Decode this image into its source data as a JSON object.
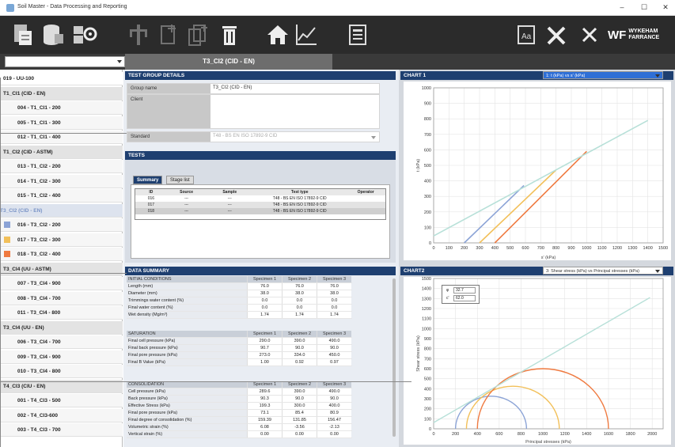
{
  "window": {
    "title": "Soil Master - Data Processing and Reporting",
    "min": "–",
    "max": "☐",
    "close": "✕"
  },
  "toolbar": {
    "icons": [
      "report-icon",
      "database-icon",
      "settings-gear-icon",
      "tree-icon",
      "new-document-icon",
      "copy-document-icon",
      "delete-icon",
      "home-icon",
      "chart-icon",
      "form-icon",
      "font-icon",
      "tools-icon",
      "close-icon"
    ],
    "logo_mark": "WF",
    "logo_text1": "WYKEHAM",
    "logo_text2": "FARRANCE"
  },
  "tab": {
    "label": "T3_CI2 (CID - EN)"
  },
  "sidebar": {
    "items": [
      {
        "label": "019 - UU-100",
        "kind": "top"
      },
      {
        "label": "T1_CI1 (CID - EN)",
        "kind": "grp"
      },
      {
        "label": "004 - T1_CI1 - 200",
        "kind": "item"
      },
      {
        "label": "005 - T1_CI1 - 300",
        "kind": "item"
      },
      {
        "label": "012 - T1_CI1 - 400",
        "kind": "item"
      },
      {
        "label": "T1_CI2 (CID - ASTM)",
        "kind": "grp"
      },
      {
        "label": "013 - T1_CI2 - 200",
        "kind": "item"
      },
      {
        "label": "014 - T1_CI2 - 300",
        "kind": "item"
      },
      {
        "label": "015 - T1_CI2 - 400",
        "kind": "item"
      },
      {
        "label": "T3_CI2 (CID - EN)",
        "kind": "sel"
      },
      {
        "label": "016 - T3_CI2 - 200",
        "kind": "item",
        "swatch": "#8ba3d6"
      },
      {
        "label": "017 - T3_CI2 - 300",
        "kind": "item",
        "swatch": "#f2c05a"
      },
      {
        "label": "018 - T3_CI2 - 400",
        "kind": "item",
        "swatch": "#ef7a40"
      },
      {
        "label": "T3_CI4 (UU - ASTM)",
        "kind": "grp"
      },
      {
        "label": "007 - T3_CI4 - 900",
        "kind": "item"
      },
      {
        "label": "008 - T3_CI4 - 700",
        "kind": "item"
      },
      {
        "label": "011 - T3_CI4 - 800",
        "kind": "item"
      },
      {
        "label": "T3_CI4 (UU - EN)",
        "kind": "grp"
      },
      {
        "label": "006 - T3_CI4 - 700",
        "kind": "item"
      },
      {
        "label": "009 - T3_CI4 - 900",
        "kind": "item"
      },
      {
        "label": "010 - T3_CI4 - 800",
        "kind": "item"
      },
      {
        "label": "T4_CI3 (CIU - EN)",
        "kind": "grp"
      },
      {
        "label": "001 - T4_CI3 - 500",
        "kind": "item"
      },
      {
        "label": "002 - T4_CI3-600",
        "kind": "item"
      },
      {
        "label": "003 - T4_CI3 - 700",
        "kind": "item"
      }
    ]
  },
  "test_group": {
    "header": "TEST GROUP DETAILS",
    "group_name_label": "Group name",
    "group_name_value": "T3_CI2 (CID - EN)",
    "client_label": "Client",
    "standard_label": "Standard",
    "standard_value": "T48 - BS EN ISO 17892-9 CID"
  },
  "tests": {
    "header": "TESTS",
    "tab_summary": "Summary",
    "tab_stage": "Stage list",
    "columns": [
      "ID",
      "Source",
      "Sample",
      "Test type",
      "Operator"
    ],
    "rows": [
      [
        "016",
        "---",
        "---",
        "T48 - BS EN ISO 17892-9 CID",
        ""
      ],
      [
        "017",
        "---",
        "---",
        "T48 - BS EN ISO 17892-9 CID",
        ""
      ],
      [
        "018",
        "---",
        "---",
        "T48 - BS EN ISO 17892-9 CID",
        ""
      ]
    ]
  },
  "data_summary": {
    "header": "DATA SUMMARY",
    "sections": [
      {
        "title": "INITIAL CONDITIONS",
        "cols": [
          "Specimen 1",
          "Specimen 2",
          "Specimen 3"
        ],
        "rows": [
          [
            "Length (mm)",
            "76.0",
            "76.0",
            "76.0"
          ],
          [
            "Diameter (mm)",
            "38.0",
            "38.0",
            "38.0"
          ],
          [
            "Trimmings water content (%)",
            "0.0",
            "0.0",
            "0.0"
          ],
          [
            "Final water content (%)",
            "0.0",
            "0.0",
            "0.0"
          ],
          [
            "Wet density (Mg/m³)",
            "1.74",
            "1.74",
            "1.74"
          ]
        ]
      },
      {
        "title": "SATURATION",
        "cols": [
          "Specimen 1",
          "Specimen 2",
          "Specimen 3"
        ],
        "rows": [
          [
            "Final cell pressure (kPa)",
            "290.0",
            "390.0",
            "490.0"
          ],
          [
            "Final back pressure (kPa)",
            "90.7",
            "90.0",
            "90.0"
          ],
          [
            "Final pore pressure (kPa)",
            "273.0",
            "334.0",
            "450.0"
          ],
          [
            "Final B Value (kPa)",
            "1.00",
            "0.92",
            "0.97"
          ]
        ]
      },
      {
        "title": "CONSOLIDATION",
        "cols": [
          "Specimen 1",
          "Specimen 2",
          "Specimen 3"
        ],
        "rows": [
          [
            "Cell pressure (kPa)",
            "289.6",
            "390.0",
            "490.0"
          ],
          [
            "Back pressure (kPa)",
            "90.3",
            "90.0",
            "90.0"
          ],
          [
            "Effective Stress (kPa)",
            "199.3",
            "300.0",
            "400.0"
          ],
          [
            "Final pore pressure (kPa)",
            "73.1",
            "85.4",
            "80.9"
          ],
          [
            "Final degree of consolidation (%)",
            "159.39",
            "131.85",
            "156.47"
          ],
          [
            "Volumetric strain (%)",
            "6.08",
            "-3.56",
            "-2.13"
          ],
          [
            "Vertical strain (%)",
            "0.00",
            "0.00",
            "0.00"
          ]
        ]
      }
    ]
  },
  "chart1": {
    "header": "CHART 1",
    "select": "1: t (kPa) vs s' (kPa)"
  },
  "chart2": {
    "header": "CHART2",
    "select": "3: Shear stress (kPa) vs Principal stresses (kPa)",
    "phi_label": "φ",
    "phi_value": "32.7",
    "c_label": "c'",
    "c_value": "62.0"
  },
  "chart_data": [
    {
      "type": "line",
      "title": "",
      "xlabel": "s' (kPa)",
      "ylabel": "t (kPa)",
      "xlim": [
        0,
        1500
      ],
      "ylim": [
        0,
        1000
      ],
      "xticks": [
        0,
        100,
        200,
        300,
        400,
        500,
        600,
        700,
        800,
        900,
        1000,
        1100,
        1200,
        1300,
        1400,
        1500
      ],
      "yticks": [
        0,
        100,
        200,
        300,
        400,
        500,
        600,
        700,
        800,
        900,
        1000
      ],
      "grid": true,
      "series": [
        {
          "color": "#8ba3d6",
          "x": [
            200,
            590
          ],
          "y": [
            0,
            370
          ]
        },
        {
          "color": "#f2c05a",
          "x": [
            300,
            800
          ],
          "y": [
            0,
            470
          ]
        },
        {
          "color": "#ef7a40",
          "x": [
            400,
            1000
          ],
          "y": [
            0,
            590
          ]
        },
        {
          "color": "#b7e0d8",
          "x": [
            0,
            1400
          ],
          "y": [
            45,
            790
          ]
        }
      ]
    },
    {
      "type": "line",
      "title": "",
      "xlabel": "Principal stresses (kPa)",
      "ylabel": "Shear stress (kPa)",
      "xlim": [
        0,
        2100
      ],
      "ylim": [
        0,
        1500
      ],
      "xticks": [
        0,
        200,
        400,
        600,
        800,
        1000,
        1200,
        1400,
        1600,
        1800,
        2000
      ],
      "yticks": [
        0,
        100,
        200,
        300,
        400,
        500,
        600,
        700,
        800,
        900,
        1000,
        1100,
        1200,
        1300,
        1400,
        1500
      ],
      "grid": true,
      "circles": [
        {
          "color": "#8ba3d6",
          "s1": 200,
          "s3": 850
        },
        {
          "color": "#f2c05a",
          "s1": 300,
          "s3": 1150
        },
        {
          "color": "#ef7a40",
          "s1": 400,
          "s3": 1600
        }
      ],
      "envelope": {
        "color": "#b7e0d8",
        "x": [
          0,
          1980
        ],
        "y": [
          62,
          1310
        ]
      }
    }
  ]
}
